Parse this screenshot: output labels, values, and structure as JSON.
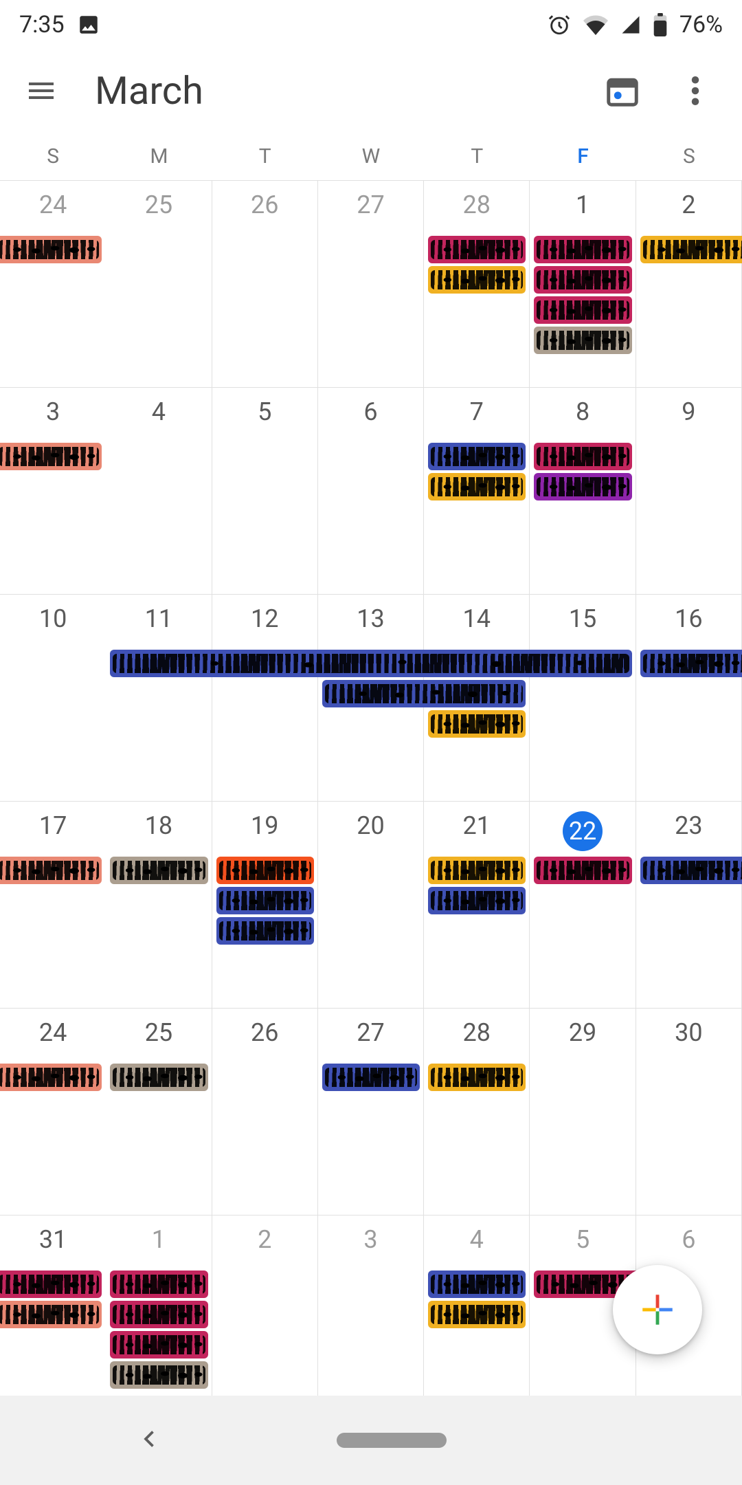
{
  "status": {
    "time": "7:35",
    "battery": "76%"
  },
  "header": {
    "title": "March"
  },
  "dow": [
    "S",
    "M",
    "T",
    "W",
    "T",
    "F",
    "S"
  ],
  "today_col_index": 5,
  "weeks": [
    {
      "days": [
        {
          "num": "24",
          "other": true
        },
        {
          "num": "25",
          "other": true
        },
        {
          "num": "26",
          "other": true
        },
        {
          "num": "27",
          "other": true
        },
        {
          "num": "28",
          "other": true
        },
        {
          "num": "1"
        },
        {
          "num": "2"
        }
      ],
      "events": [
        {
          "row": 0,
          "start": 0,
          "end": 0,
          "color": "salmon",
          "bleed_left": true,
          "redacted": true
        },
        {
          "row": 0,
          "start": 4,
          "end": 4,
          "color": "crimson",
          "redacted": true
        },
        {
          "row": 0,
          "start": 5,
          "end": 5,
          "color": "crimson",
          "redacted": true
        },
        {
          "row": 0,
          "start": 6,
          "end": 6,
          "color": "gold",
          "bleed_right": true,
          "redacted": true
        },
        {
          "row": 1,
          "start": 4,
          "end": 4,
          "color": "gold",
          "redacted": true
        },
        {
          "row": 1,
          "start": 5,
          "end": 5,
          "color": "crimson",
          "redacted": true
        },
        {
          "row": 2,
          "start": 5,
          "end": 5,
          "color": "crimson",
          "redacted": true
        },
        {
          "row": 3,
          "start": 5,
          "end": 5,
          "color": "taupe",
          "redacted": true
        }
      ]
    },
    {
      "days": [
        {
          "num": "3"
        },
        {
          "num": "4"
        },
        {
          "num": "5"
        },
        {
          "num": "6"
        },
        {
          "num": "7"
        },
        {
          "num": "8"
        },
        {
          "num": "9"
        }
      ],
      "events": [
        {
          "row": 0,
          "start": 0,
          "end": 0,
          "color": "salmon",
          "bleed_left": true,
          "redacted": true
        },
        {
          "row": 0,
          "start": 4,
          "end": 4,
          "color": "indigo",
          "redacted": true
        },
        {
          "row": 0,
          "start": 5,
          "end": 5,
          "color": "crimson",
          "redacted": true
        },
        {
          "row": 1,
          "start": 4,
          "end": 4,
          "color": "gold",
          "redacted": true
        },
        {
          "row": 1,
          "start": 5,
          "end": 5,
          "color": "purple",
          "redacted": true
        }
      ]
    },
    {
      "days": [
        {
          "num": "10"
        },
        {
          "num": "11"
        },
        {
          "num": "12"
        },
        {
          "num": "13"
        },
        {
          "num": "14"
        },
        {
          "num": "15"
        },
        {
          "num": "16"
        }
      ],
      "events": [
        {
          "row": 0,
          "start": 1,
          "end": 5,
          "color": "indigo",
          "redacted": true
        },
        {
          "row": 0,
          "start": 6,
          "end": 6,
          "color": "indigo",
          "bleed_right": true,
          "redacted": true
        },
        {
          "row": 1,
          "start": 3,
          "end": 4,
          "color": "indigo",
          "redacted": true
        },
        {
          "row": 2,
          "start": 4,
          "end": 4,
          "color": "gold",
          "redacted": true
        }
      ]
    },
    {
      "days": [
        {
          "num": "17"
        },
        {
          "num": "18"
        },
        {
          "num": "19"
        },
        {
          "num": "20"
        },
        {
          "num": "21"
        },
        {
          "num": "22",
          "today": true
        },
        {
          "num": "23"
        }
      ],
      "events": [
        {
          "row": 0,
          "start": 0,
          "end": 0,
          "color": "salmon",
          "bleed_left": true,
          "redacted": true
        },
        {
          "row": 0,
          "start": 1,
          "end": 1,
          "color": "taupe",
          "redacted": true
        },
        {
          "row": 0,
          "start": 2,
          "end": 2,
          "color": "orange",
          "redacted": true
        },
        {
          "row": 0,
          "start": 4,
          "end": 4,
          "color": "gold",
          "redacted": true
        },
        {
          "row": 0,
          "start": 5,
          "end": 5,
          "color": "crimson",
          "redacted": true
        },
        {
          "row": 0,
          "start": 6,
          "end": 6,
          "color": "indigo",
          "bleed_right": true,
          "redacted": true
        },
        {
          "row": 1,
          "start": 2,
          "end": 2,
          "color": "indigo",
          "redacted": true
        },
        {
          "row": 1,
          "start": 4,
          "end": 4,
          "color": "indigo",
          "redacted": true
        },
        {
          "row": 2,
          "start": 2,
          "end": 2,
          "color": "indigo",
          "redacted": true
        }
      ]
    },
    {
      "days": [
        {
          "num": "24"
        },
        {
          "num": "25"
        },
        {
          "num": "26"
        },
        {
          "num": "27"
        },
        {
          "num": "28"
        },
        {
          "num": "29"
        },
        {
          "num": "30"
        }
      ],
      "events": [
        {
          "row": 0,
          "start": 0,
          "end": 0,
          "color": "salmon",
          "bleed_left": true,
          "redacted": true
        },
        {
          "row": 0,
          "start": 1,
          "end": 1,
          "color": "taupe",
          "redacted": true
        },
        {
          "row": 0,
          "start": 3,
          "end": 3,
          "color": "indigo",
          "redacted": true
        },
        {
          "row": 0,
          "start": 4,
          "end": 4,
          "color": "gold",
          "redacted": true
        }
      ]
    },
    {
      "days": [
        {
          "num": "31"
        },
        {
          "num": "1",
          "other": true
        },
        {
          "num": "2",
          "other": true
        },
        {
          "num": "3",
          "other": true
        },
        {
          "num": "4",
          "other": true
        },
        {
          "num": "5",
          "other": true
        },
        {
          "num": "6",
          "other": true
        }
      ],
      "events": [
        {
          "row": 0,
          "start": 0,
          "end": 0,
          "color": "crimson",
          "bleed_left": true,
          "redacted": true
        },
        {
          "row": 0,
          "start": 1,
          "end": 1,
          "color": "crimson",
          "redacted": true
        },
        {
          "row": 0,
          "start": 4,
          "end": 4,
          "color": "indigo",
          "redacted": true
        },
        {
          "row": 0,
          "start": 5,
          "end": 5,
          "color": "crimson",
          "bleed_right": true,
          "redacted": true
        },
        {
          "row": 1,
          "start": 0,
          "end": 0,
          "color": "salmon",
          "bleed_left": true,
          "redacted": true
        },
        {
          "row": 1,
          "start": 1,
          "end": 1,
          "color": "crimson",
          "redacted": true
        },
        {
          "row": 1,
          "start": 4,
          "end": 4,
          "color": "gold",
          "redacted": true
        },
        {
          "row": 2,
          "start": 1,
          "end": 1,
          "color": "crimson",
          "redacted": true
        },
        {
          "row": 3,
          "start": 1,
          "end": 1,
          "color": "taupe",
          "redacted": true
        }
      ]
    }
  ]
}
